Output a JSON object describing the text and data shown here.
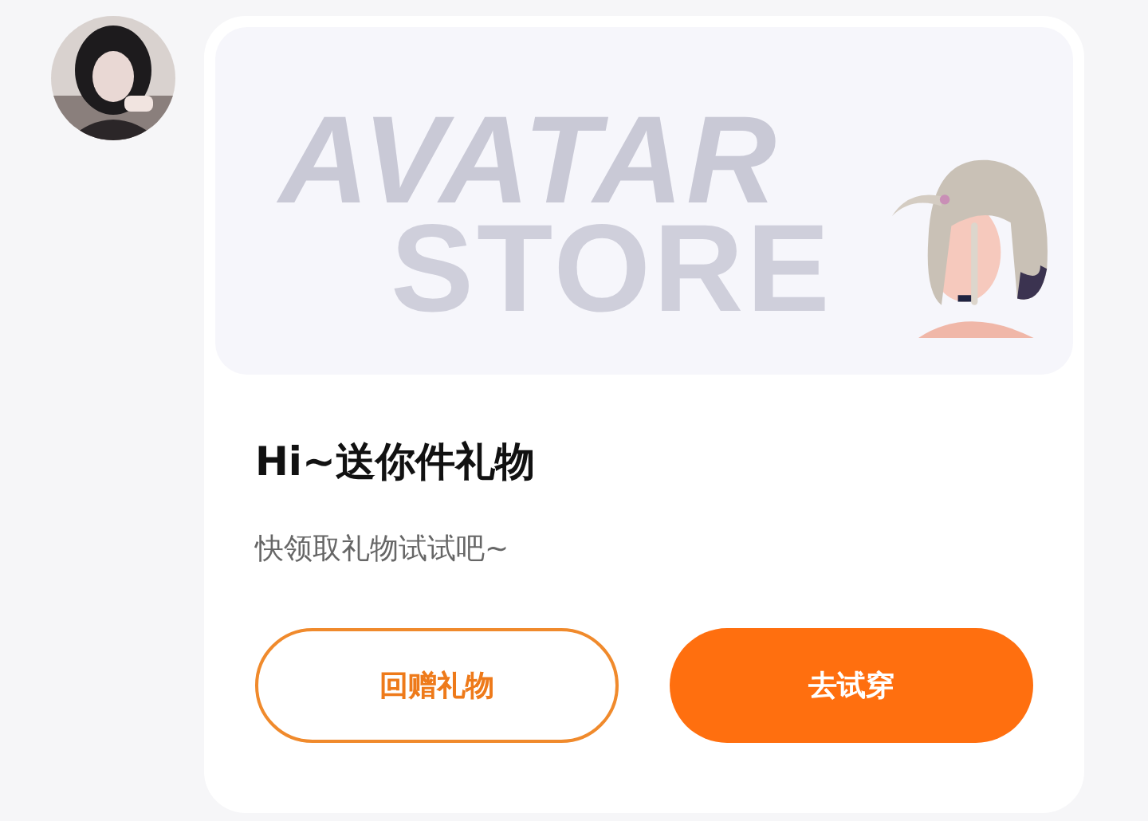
{
  "banner": {
    "words": [
      "AVATAR",
      "STORE"
    ]
  },
  "title": "Hi~送你件礼物",
  "subtitle": "快领取礼物试试吧~",
  "buttons": [
    {
      "label": "回赠礼物",
      "kind": "outline"
    },
    {
      "label": "去试穿",
      "kind": "filled"
    }
  ]
}
